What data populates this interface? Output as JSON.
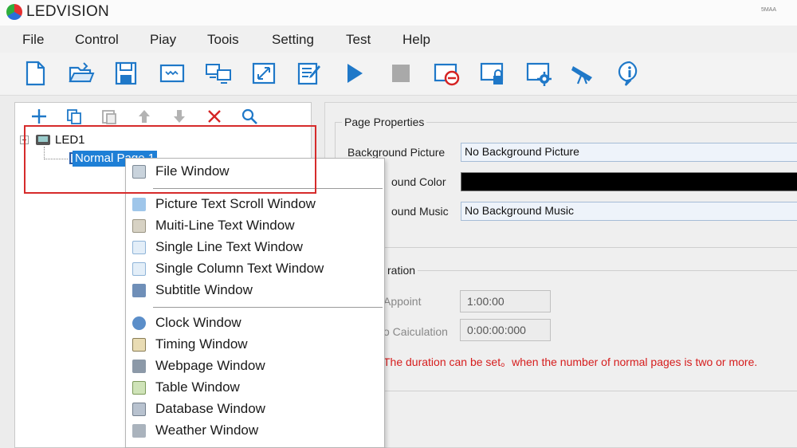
{
  "app": {
    "title": "LEDVISION",
    "titlebar_small_text": "5MAA"
  },
  "menu": [
    "File",
    "Control",
    "Piay",
    "Toois",
    "Setting",
    "Test",
    "Help"
  ],
  "toolbar": {
    "icons": [
      "new-file-icon",
      "open-folder-icon",
      "save-icon",
      "screen-icon",
      "network-monitor-icon",
      "resize-window-icon",
      "edit-note-icon",
      "play-icon",
      "stop-icon",
      "clear-screen-icon",
      "lock-screen-icon",
      "settings-screen-icon",
      "broadcast-icon",
      "info-icon"
    ]
  },
  "tree": {
    "led_label": "LED1",
    "page_label": "Normal Page 1"
  },
  "context_menu": {
    "group1": [
      "File Window"
    ],
    "group2": [
      "Picture Text Scroll Window",
      "Muiti-Line Text Window",
      "Single Line Text Window",
      "Single Column Text Window",
      "Subtitle Window"
    ],
    "group3": [
      "Clock Window",
      "Timing Window",
      "Webpage Window",
      "Table Window",
      "Database Window",
      "Weather Window"
    ]
  },
  "page_properties": {
    "legend": "Page Properties",
    "background_picture_label": "Background Picture",
    "background_picture_value": "No Background Picture",
    "background_color_label": "ound Color",
    "background_color_value": "#000000",
    "background_music_label": "ound Music",
    "background_music_value": "No Background Music"
  },
  "duration": {
    "legend": "ration",
    "appoint_label": "Appoint",
    "appoint_value": "1:00:00",
    "calculation_label": "o Caiculation",
    "calculation_value": "0:00:00:000",
    "note": "The duration can be set。when the number of normal pages is two or more."
  },
  "colors": {
    "accent_blue": "#1e7fd6",
    "highlight_red": "#d62b2b",
    "note_red": "#d61d1d"
  }
}
